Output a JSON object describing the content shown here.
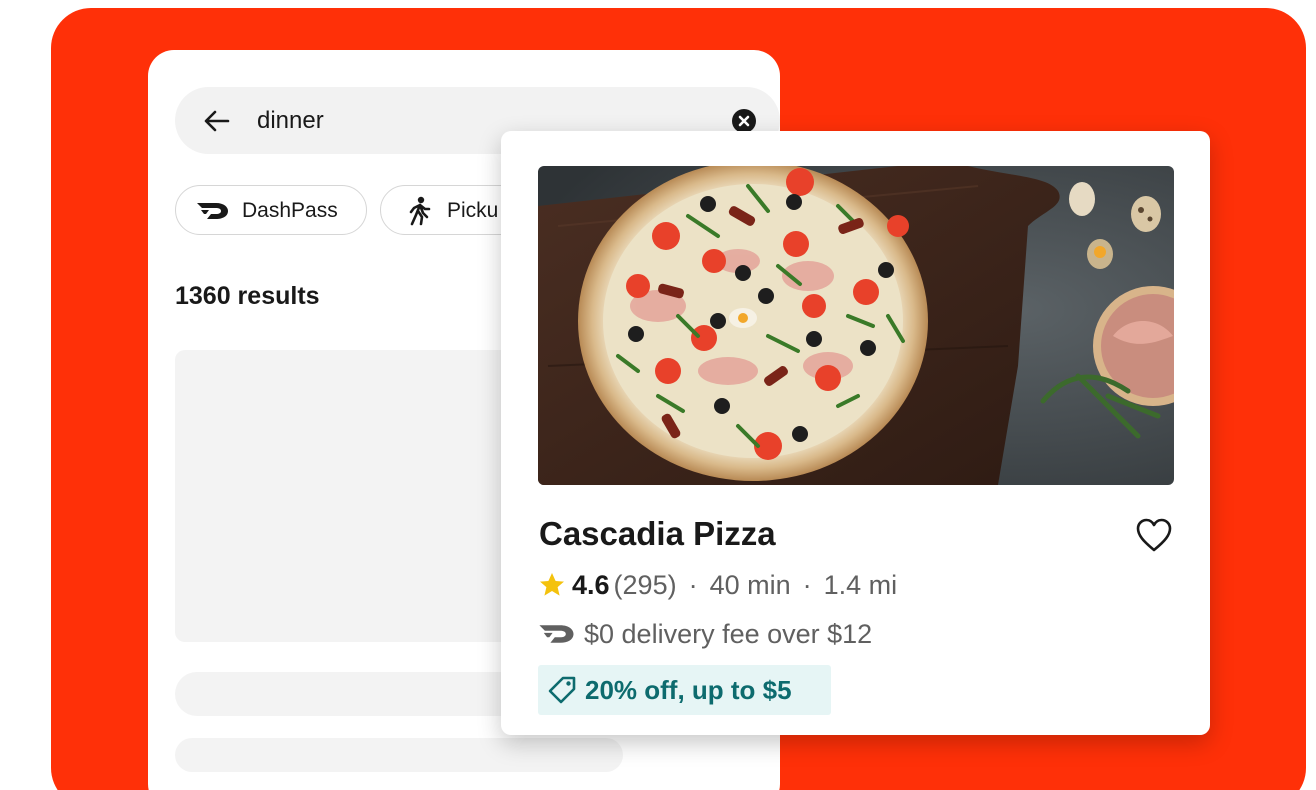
{
  "colors": {
    "brand_red": "#ff3008",
    "star_yellow": "#f4c20d",
    "promo_teal": "#0d6b6e",
    "promo_bg": "#e6f5f5"
  },
  "search": {
    "query": "dinner",
    "back_icon": "arrow-left-icon",
    "clear_icon": "close-circle-icon"
  },
  "filters": [
    {
      "label": "DashPass",
      "icon": "dashpass-icon"
    },
    {
      "label": "Picku",
      "icon": "walking-person-icon"
    }
  ],
  "results": {
    "count_label": "1360 results"
  },
  "store": {
    "photo": "pizza-photo",
    "name": "Cascadia Pizza",
    "rating": "4.6",
    "rating_count": "(295)",
    "separator": "·",
    "delivery_time": "40 min",
    "distance": "1.4 mi",
    "delivery_fee": "$0 delivery fee over $12",
    "promo": "20% off, up to $5"
  }
}
